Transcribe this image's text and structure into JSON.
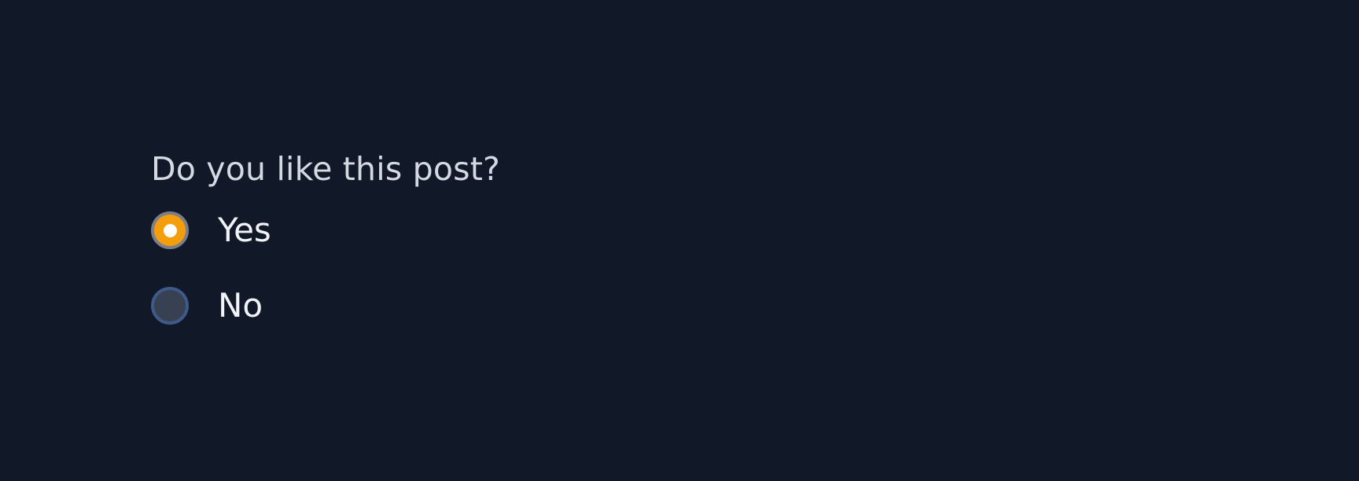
{
  "question": "Do you like this post?",
  "options": [
    {
      "label": "Yes",
      "selected": true
    },
    {
      "label": "No",
      "selected": false
    }
  ],
  "colors": {
    "background": "#111827",
    "question_text": "#d5d9e1",
    "option_text": "#f1f3f6",
    "selected_radio": "#f59e0b",
    "selected_radio_border": "#7d7f88",
    "selected_radio_dot": "#ffffff",
    "unselected_radio": "#374151",
    "unselected_radio_border": "#3d5a8a"
  }
}
